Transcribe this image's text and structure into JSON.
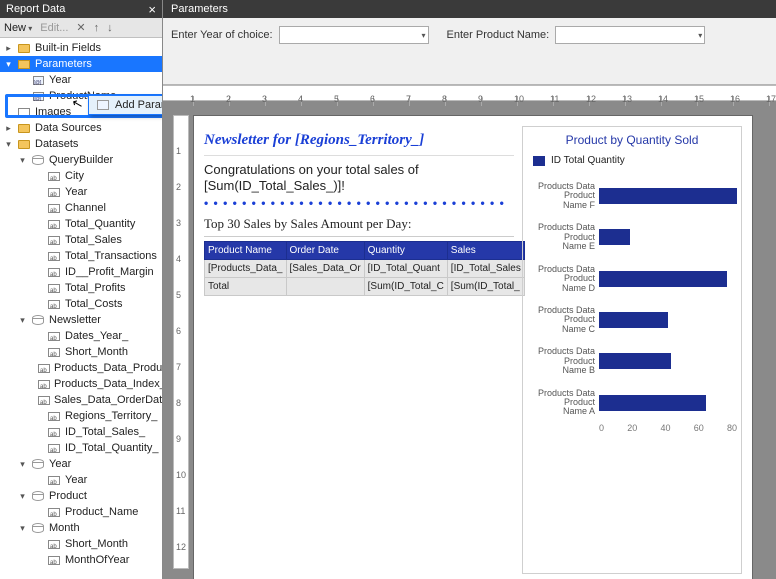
{
  "leftpanel": {
    "title": "Report Data",
    "toolbar": {
      "new": "New",
      "edit": "Edit..."
    },
    "ctx_menu": {
      "add_param": "Add Parameter..."
    },
    "tree": {
      "builtins": "Built-in Fields",
      "parameters": "Parameters",
      "param_items": [
        "Year",
        "ProductName"
      ],
      "images": "Images",
      "data_sources": "Data Sources",
      "datasets": "Datasets",
      "ds": [
        {
          "name": "QueryBuilder",
          "fields": [
            "City",
            "Year",
            "Channel",
            "Total_Quantity",
            "Total_Sales",
            "Total_Transactions",
            "ID__Profit_Margin",
            "Total_Profits",
            "Total_Costs"
          ]
        },
        {
          "name": "Newsletter",
          "fields": [
            "Dates_Year_",
            "Short_Month",
            "Products_Data_Product...",
            "Products_Data_Index_",
            "Sales_Data_OrderDate_",
            "Regions_Territory_",
            "ID_Total_Sales_",
            "ID_Total_Quantity_"
          ]
        },
        {
          "name": "Year",
          "fields": [
            "Year"
          ]
        },
        {
          "name": "Product",
          "fields": [
            "Product_Name"
          ]
        },
        {
          "name": "Month",
          "fields": [
            "Short_Month",
            "MonthOfYear"
          ]
        }
      ]
    }
  },
  "parameters_pane": {
    "title": "Parameters",
    "p1_label": "Enter Year of choice:",
    "p2_label": "Enter Product Name:"
  },
  "ruler_ticks": [
    "1",
    "2",
    "3",
    "4",
    "5",
    "6",
    "7",
    "8",
    "9",
    "10",
    "11",
    "12",
    "13",
    "14",
    "15",
    "16",
    "17"
  ],
  "vruler_ticks": [
    "1",
    "2",
    "3",
    "4",
    "5",
    "6",
    "7",
    "8",
    "9",
    "10",
    "11",
    "12"
  ],
  "report": {
    "heading": "Newsletter for [Regions_Territory_]",
    "congrats_1": "Congratulations on your total sales of",
    "congrats_2": "[Sum(ID_Total_Sales_)]!",
    "top30": "Top 30 Sales by Sales Amount per Day:",
    "cols": [
      "Product Name",
      "Order Date",
      "Quantity",
      "Sales"
    ],
    "row1": [
      "[Products_Data_",
      "[Sales_Data_Or",
      "[ID_Total_Quant",
      "[ID_Total_Sales"
    ],
    "row2": [
      "Total",
      "",
      "[Sum(ID_Total_C",
      "[Sum(ID_Total_"
    ]
  },
  "chart_data": {
    "type": "bar",
    "title": "Product by Quantity Sold",
    "legend": "ID Total Quantity",
    "categories": [
      "Products Data Product Name F",
      "Products Data Product Name E",
      "Products Data Product Name D",
      "Products Data Product Name C",
      "Products Data Product Name B",
      "Products Data Product Name A"
    ],
    "values": [
      88,
      18,
      74,
      40,
      42,
      62
    ],
    "xlabel": "",
    "ylabel": "",
    "xlim": [
      0,
      80
    ],
    "axis_ticks": [
      "0",
      "20",
      "40",
      "60",
      "80"
    ]
  }
}
